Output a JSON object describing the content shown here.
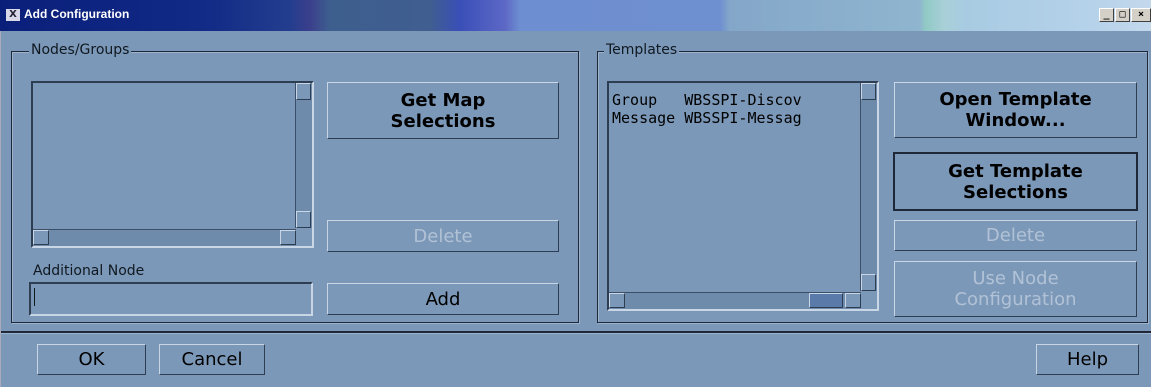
{
  "window": {
    "title": "Add Configuration",
    "icon_glyph": "X"
  },
  "nodes": {
    "frame_label": "Nodes/Groups",
    "get_map_label": "Get Map\nSelections",
    "delete_label": "Delete",
    "additional_label": "Additional Node",
    "additional_value": "",
    "add_label": "Add"
  },
  "templates": {
    "frame_label": "Templates",
    "items": [
      "Group   WBSSPI-Discov",
      "Message WBSSPI-Messag"
    ],
    "open_label": "Open Template\nWindow...",
    "get_label": "Get Template\nSelections",
    "delete_label": "Delete",
    "use_node_label": "Use Node\nConfiguration"
  },
  "footer": {
    "ok": "OK",
    "cancel": "Cancel",
    "help": "Help"
  },
  "colors": {
    "background": "#7b98b8",
    "disabled_text": "#b2c2d6"
  }
}
